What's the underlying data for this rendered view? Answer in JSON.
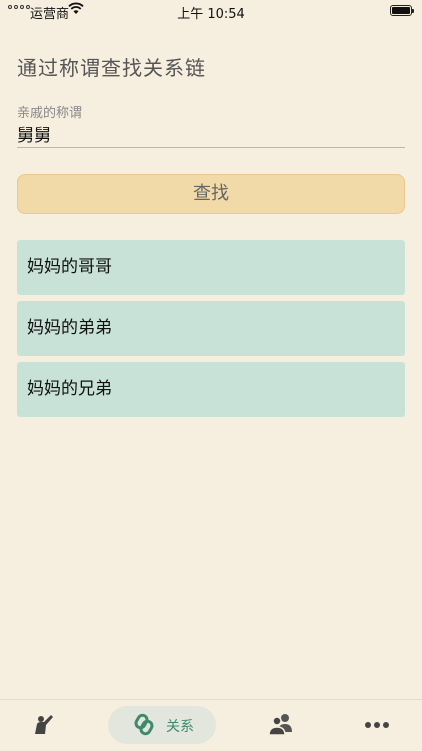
{
  "status_bar": {
    "carrier": "运营商",
    "time": "上午 10:54"
  },
  "page": {
    "title": "通过称谓查找关系链"
  },
  "form": {
    "label": "亲戚的称谓",
    "value": "舅舅",
    "search_button": "查找"
  },
  "results": [
    "妈妈的哥哥",
    "妈妈的弟弟",
    "妈妈的兄弟"
  ],
  "tab_bar": {
    "active_tab": "关系",
    "tabs": [
      {
        "icon": "person-raising-hand-icon"
      },
      {
        "icon": "chain-link-icon",
        "label": "关系"
      },
      {
        "icon": "two-people-icon"
      },
      {
        "icon": "more-dots-icon"
      }
    ],
    "active_color": "#3f8a6d"
  }
}
